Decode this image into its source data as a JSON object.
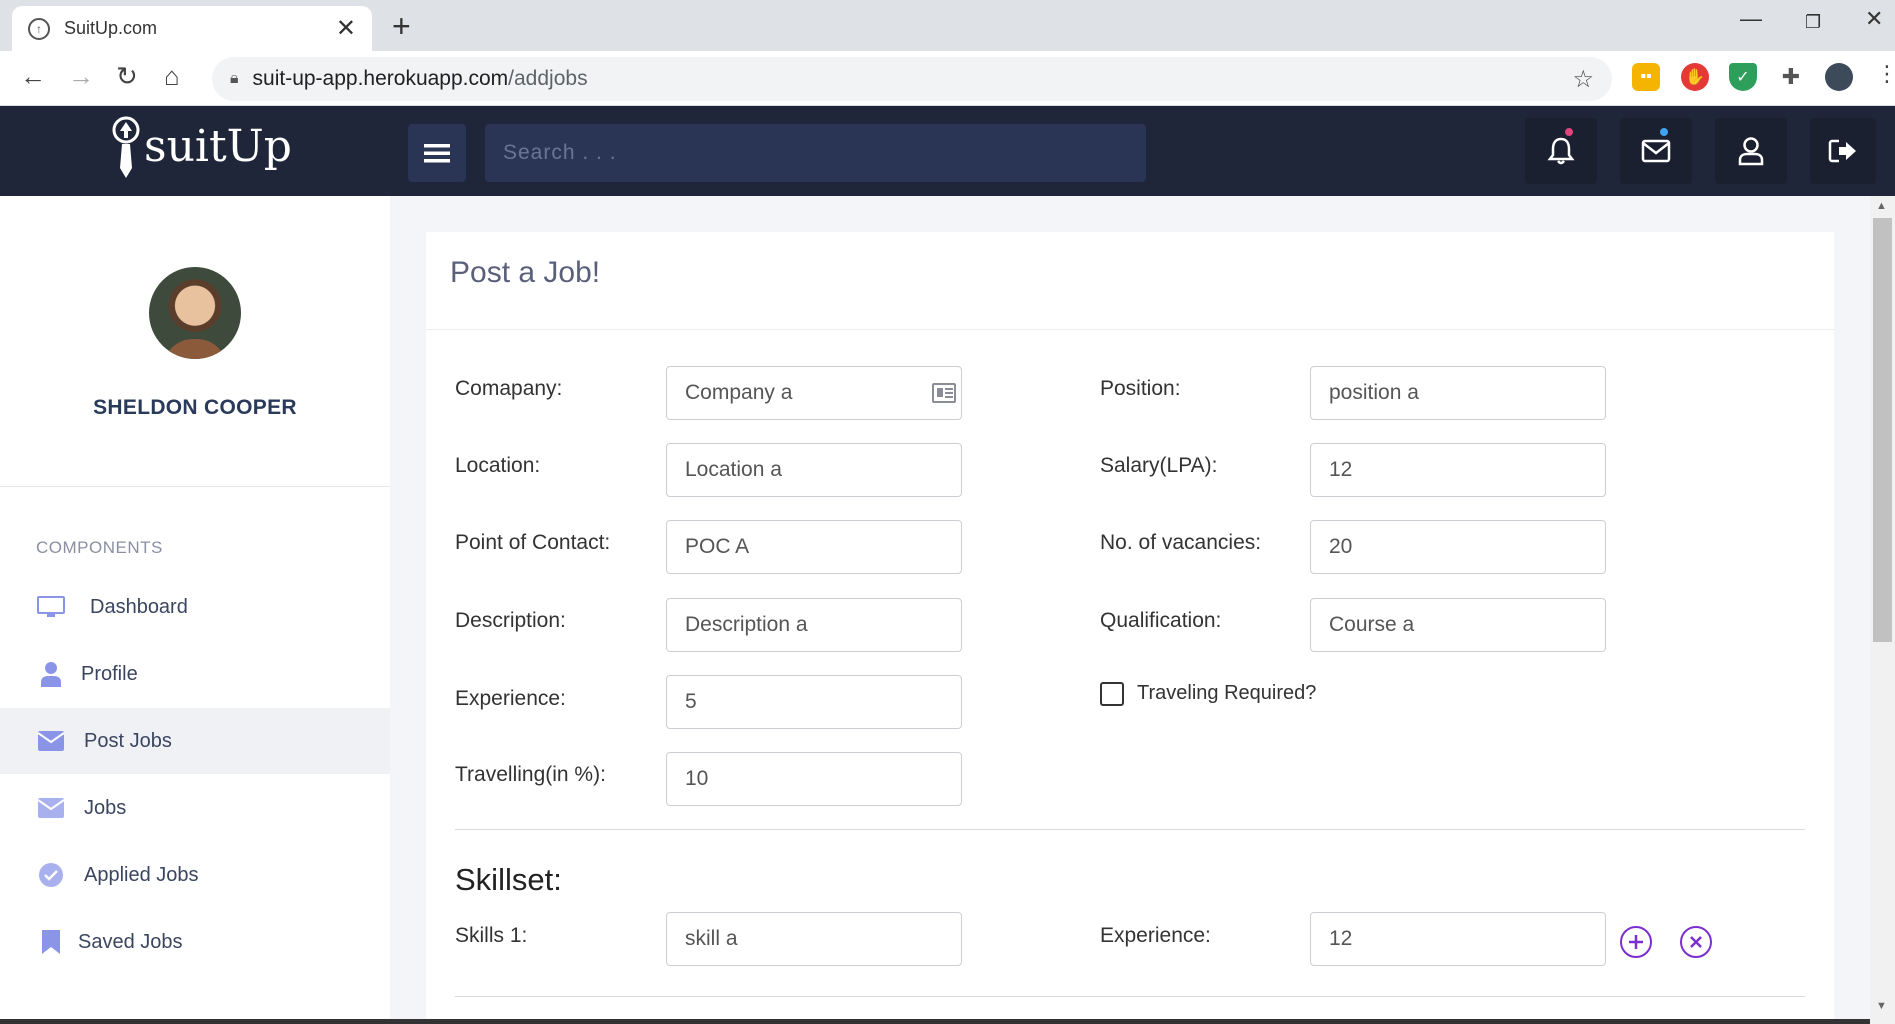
{
  "browser": {
    "tab_title": "SuitUp.com",
    "tab_close": "✕",
    "new_tab": "+",
    "url_host": "suit-up-app.herokuapp.com",
    "url_path": "/addjobs"
  },
  "app": {
    "logo_text": "suitUp",
    "search_placeholder": "Search . . ."
  },
  "sidebar": {
    "user_name": "SHELDON COOPER",
    "section_label": "COMPONENTS",
    "items": [
      {
        "label": "Dashboard"
      },
      {
        "label": "Profile"
      },
      {
        "label": "Post Jobs"
      },
      {
        "label": "Jobs"
      },
      {
        "label": "Applied Jobs"
      },
      {
        "label": "Saved Jobs"
      }
    ]
  },
  "form": {
    "title": "Post a Job!",
    "company": {
      "label": "Comapany:",
      "value": "Company a"
    },
    "location": {
      "label": "Location:",
      "value": "Location a"
    },
    "poc": {
      "label": "Point of Contact:",
      "value": "POC A"
    },
    "description": {
      "label": "Description:",
      "value": "Description a"
    },
    "experience": {
      "label": "Experience:",
      "value": "5"
    },
    "travelling": {
      "label": "Travelling(in %):",
      "value": "10"
    },
    "position": {
      "label": "Position:",
      "value": "position a"
    },
    "salary": {
      "label": "Salary(LPA):",
      "value": "12"
    },
    "vacancies": {
      "label": "No. of vacancies:",
      "value": "20"
    },
    "qualification": {
      "label": "Qualification:",
      "value": "Course a"
    },
    "traveling_required": {
      "label": "Traveling Required?",
      "checked": false
    },
    "skillset": {
      "title": "Skillset:",
      "skill_label": "Skills 1:",
      "skill_value": "skill a",
      "exp_label": "Experience:",
      "exp_value": "12"
    }
  },
  "colors": {
    "navbar": "#1f2639",
    "accent_purple": "#7b2fd0",
    "sidebar_icon": "#8b95e8",
    "notif_dot": "#e0467c",
    "mail_dot": "#3ea4f0"
  }
}
